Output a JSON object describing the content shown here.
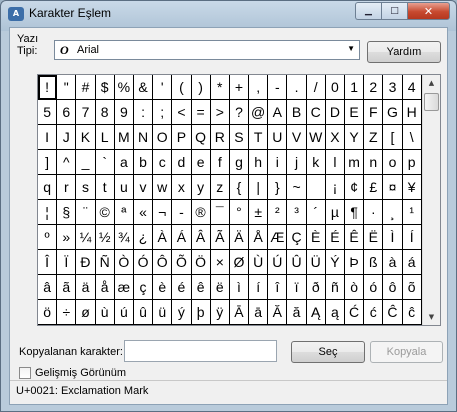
{
  "window": {
    "title": "Karakter Eşlem",
    "icon": "charmap-icon"
  },
  "caption_buttons": {
    "minimize": "▁",
    "maximize": "□",
    "close": "✕"
  },
  "font": {
    "label": "Yazı Tipi:",
    "value": "Arial",
    "glyph": "O"
  },
  "buttons": {
    "help": "Yardım",
    "select": "Seç",
    "copy": "Kopyala"
  },
  "copy_field": {
    "label": "Kopyalanan karakter:",
    "value": ""
  },
  "advanced_view": {
    "label": "Gelişmiş Görünüm",
    "checked": false
  },
  "status": "U+0021: Exclamation Mark",
  "characters": [
    "!",
    "\"",
    "#",
    "$",
    "%",
    "&",
    "'",
    "(",
    ")",
    "*",
    "+",
    ",",
    "-",
    ".",
    "/",
    "0",
    "1",
    "2",
    "3",
    "4",
    "5",
    "6",
    "7",
    "8",
    "9",
    ":",
    ";",
    "<",
    "=",
    ">",
    "?",
    "@",
    "A",
    "B",
    "C",
    "D",
    "E",
    "F",
    "G",
    "H",
    "I",
    "J",
    "K",
    "L",
    "M",
    "N",
    "O",
    "P",
    "Q",
    "R",
    "S",
    "T",
    "U",
    "V",
    "W",
    "X",
    "Y",
    "Z",
    "[",
    "\\",
    "]",
    "^",
    "_",
    "`",
    "a",
    "b",
    "c",
    "d",
    "e",
    "f",
    "g",
    "h",
    "i",
    "j",
    "k",
    "l",
    "m",
    "n",
    "o",
    "p",
    "q",
    "r",
    "s",
    "t",
    "u",
    "v",
    "w",
    "x",
    "y",
    "z",
    "{",
    "|",
    "}",
    "~",
    "",
    "¡",
    "¢",
    "£",
    "¤",
    "¥",
    "¦",
    "§",
    "¨",
    "©",
    "ª",
    "«",
    "¬",
    "-",
    "®",
    "¯",
    "°",
    "±",
    "²",
    "³",
    "´",
    "µ",
    "¶",
    "·",
    "¸",
    "¹",
    "º",
    "»",
    "¼",
    "½",
    "¾",
    "¿",
    "À",
    "Á",
    "Â",
    "Ã",
    "Ä",
    "Å",
    "Æ",
    "Ç",
    "È",
    "É",
    "Ê",
    "Ë",
    "Ì",
    "Í",
    "Î",
    "Ï",
    "Ð",
    "Ñ",
    "Ò",
    "Ó",
    "Ô",
    "Õ",
    "Ö",
    "×",
    "Ø",
    "Ù",
    "Ú",
    "Û",
    "Ü",
    "Ý",
    "Þ",
    "ß",
    "à",
    "á",
    "â",
    "ã",
    "ä",
    "å",
    "æ",
    "ç",
    "è",
    "é",
    "ê",
    "ë",
    "ì",
    "í",
    "î",
    "ï",
    "ð",
    "ñ",
    "ò",
    "ó",
    "ô",
    "õ",
    "ö",
    "÷",
    "ø",
    "ù",
    "ú",
    "û",
    "ü",
    "ý",
    "þ",
    "ÿ",
    "Ā",
    "ā",
    "Ă",
    "ă",
    "Ą",
    "ą",
    "Ć",
    "ć",
    "Ĉ",
    "ĉ"
  ],
  "selected_index": 0
}
